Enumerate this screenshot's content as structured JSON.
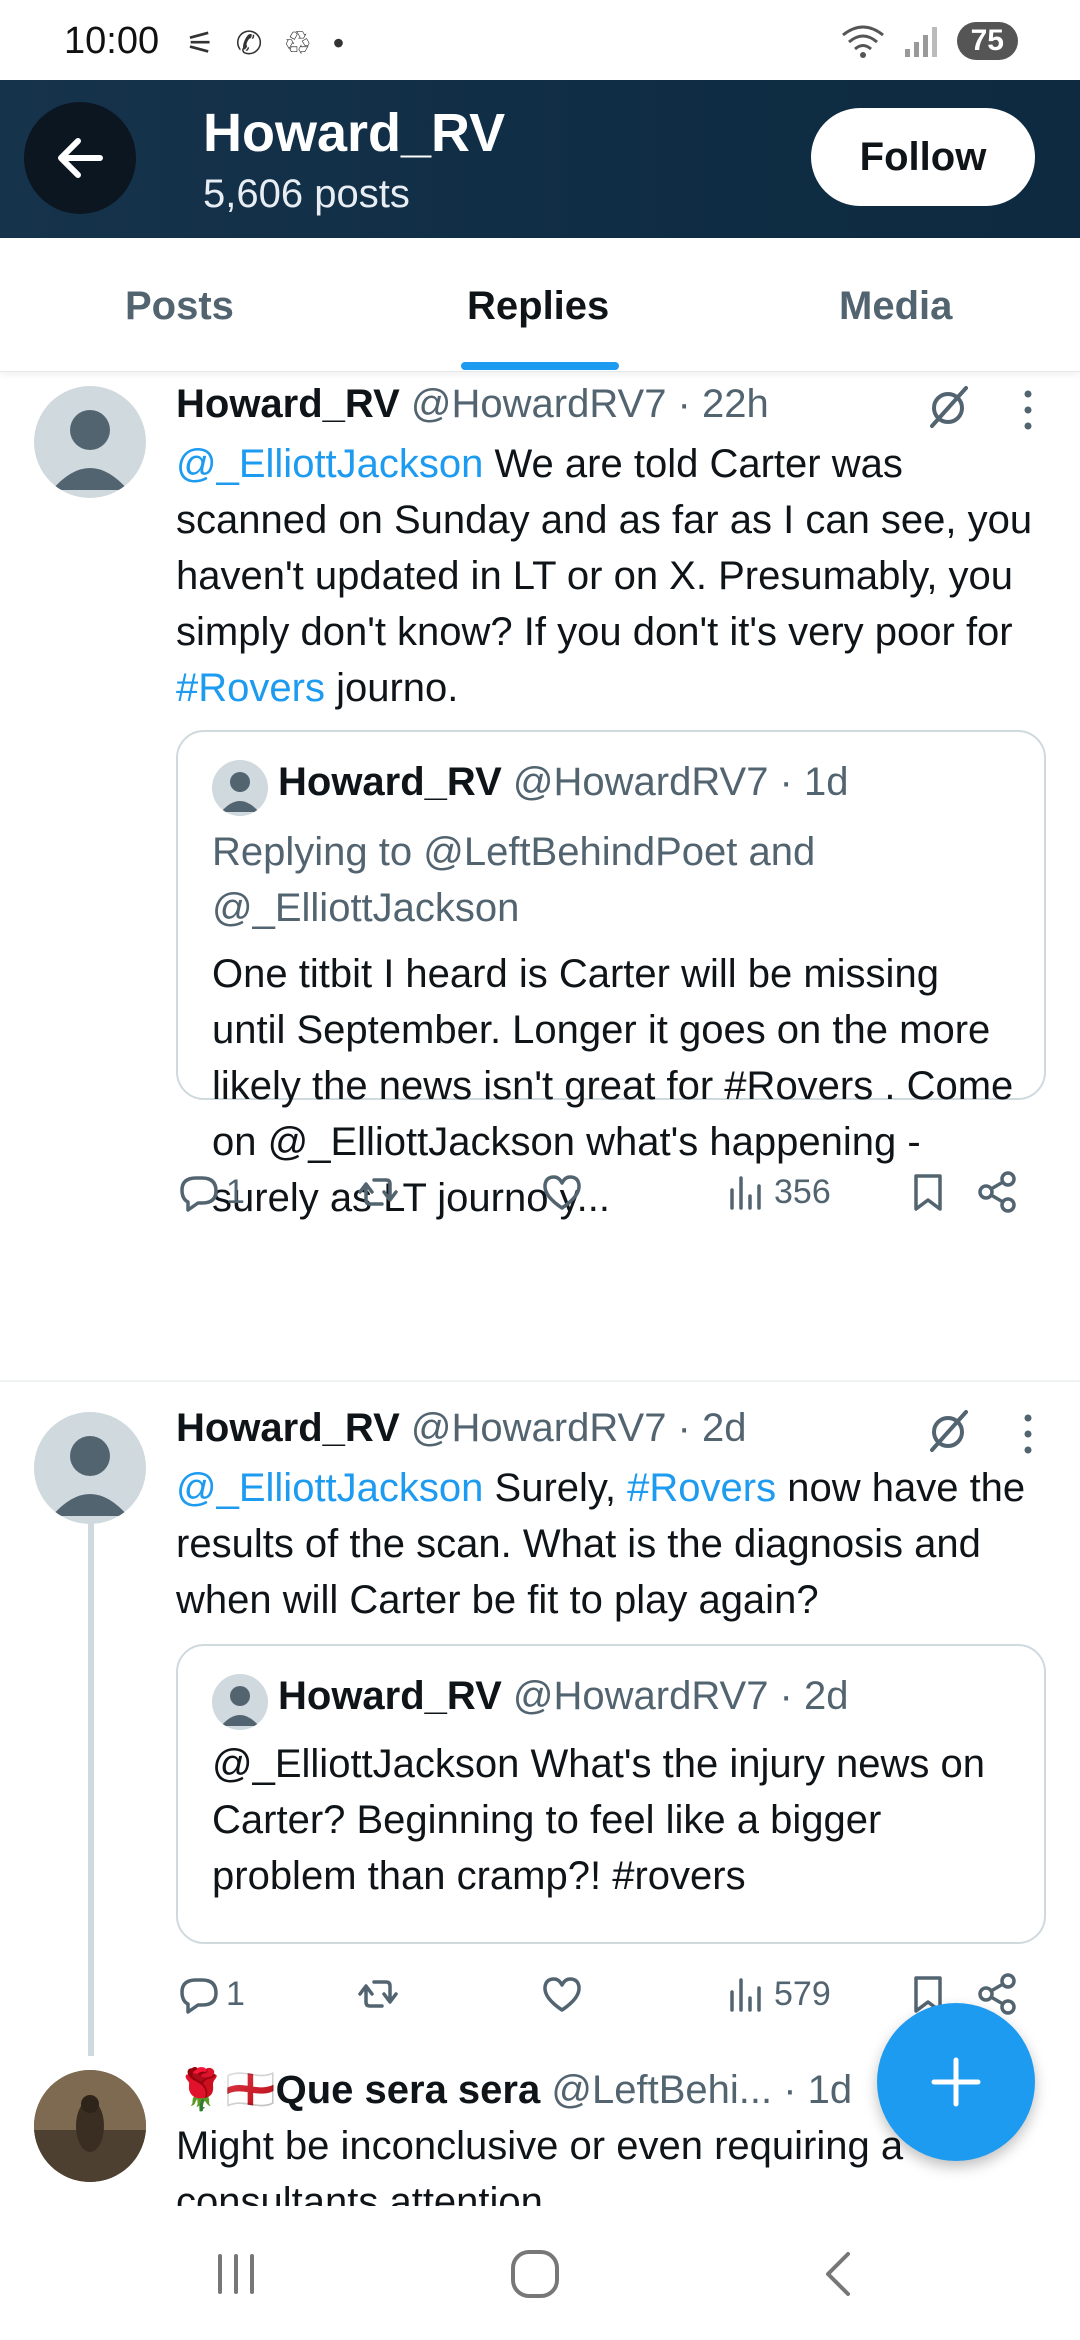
{
  "status_bar": {
    "time": "10:00",
    "notification_icons": "⚟ ✆ ♲ •",
    "battery": "75"
  },
  "header": {
    "name": "Howard_RV",
    "posts_count": "5,606 posts",
    "follow_label": "Follow"
  },
  "tabs": [
    {
      "label": "Posts"
    },
    {
      "label": "Replies"
    },
    {
      "label": "Media"
    }
  ],
  "posts": [
    {
      "name": "Howard_RV",
      "meta": "@HowardRV7 · 22h",
      "text_mention": "@_ElliottJackson",
      "text_part1": " We are told Carter was scanned on Sunday and as far as I can see, you haven't updated in LT or on X. Presumably, you simply don't know?  If you don't it's very poor for ",
      "text_hashtag": "#Rovers",
      "text_part2": " journo.",
      "quote": {
        "name": "Howard_RV",
        "meta": "@HowardRV7 · 1d",
        "replying_to": "Replying to @LeftBehindPoet and @_ElliottJackson",
        "text": "One titbit I heard is Carter will be missing until September.  Longer it goes on the more likely the news isn't great for #Rovers .  Come on @_ElliottJackson what's happening - surely as LT journo y..."
      },
      "replies": "1",
      "views": "356"
    },
    {
      "name": "Howard_RV",
      "meta": "@HowardRV7 · 2d",
      "text_mention": "@_ElliottJackson",
      "text_part1": " Surely, ",
      "text_hashtag": "#Rovers",
      "text_part2": " now have the results of the scan.  What is the diagnosis and when will Carter be fit to play again?",
      "quote": {
        "name": "Howard_RV",
        "meta": "@HowardRV7 · 2d",
        "text": "@_ElliottJackson What's the injury news on Carter?  Beginning to feel like a bigger problem than cramp?!  #rovers"
      },
      "replies": "1",
      "views": "579"
    },
    {
      "name": "🌹🏴󠁧󠁢󠁥󠁮󠁧󠁿Que sera sera",
      "meta": "@LeftBehi...",
      "time": "· 1d",
      "text": "Might be inconclusive or even requiring a consultants attention"
    }
  ],
  "icons": {
    "back": "arrow-left-icon",
    "grok": "grok-icon",
    "more": "more-vertical-icon",
    "reply": "reply-icon",
    "repost": "repost-icon",
    "like": "heart-icon",
    "views": "views-icon",
    "bookmark": "bookmark-icon",
    "share": "share-icon",
    "compose": "plus-icon"
  },
  "colors": {
    "accent": "#1d9bf0",
    "header_bg": "#0f2d44",
    "secondary_text": "#536471"
  }
}
